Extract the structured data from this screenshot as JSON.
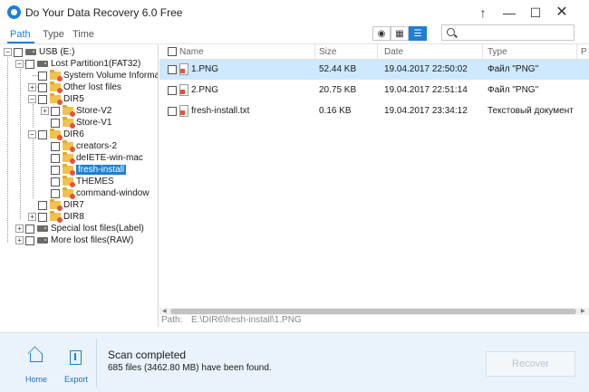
{
  "window": {
    "title": "Do Your Data Recovery 6.0 Free",
    "icons": [
      "app-logo-icon",
      "upgrade-arrow-icon",
      "minimize-icon",
      "maximize-icon",
      "close-icon"
    ]
  },
  "tabs": [
    {
      "label": "Path",
      "active": true
    },
    {
      "label": "Type",
      "active": false
    },
    {
      "label": "Time",
      "active": false
    }
  ],
  "view_modes": [
    "preview-eye-icon",
    "thumbnail-grid-icon",
    "list-view-icon"
  ],
  "active_view": "list",
  "search": {
    "value": "",
    "placeholder": ""
  },
  "tree": {
    "usb": "USB (E:)",
    "lost_partition": "Lost Partition1(FAT32)",
    "system_volume": "System Volume Information",
    "other_lost": "Other lost files",
    "dir5": "DIR5",
    "store_v2": "Store-V2",
    "store_v1": "Store-V1",
    "dir6": "DIR6",
    "creators2": "creators-2",
    "delete_win_mac": "deIETE-win-mac",
    "fresh_install": "fresh-install",
    "themes": "THEMES",
    "command_window": "command-window",
    "dir7": "DIR7",
    "dir8": "DIR8",
    "special_lost": "Special lost files(Label)",
    "more_lost": "More lost files(RAW)"
  },
  "columns": {
    "name": "Name",
    "size": "Size",
    "date": "Date",
    "type": "Type",
    "extra": "P"
  },
  "files": [
    {
      "name": "1.PNG",
      "size": "52.44 KB",
      "date": "19.04.2017 22:50:02",
      "type": "Файл \"PNG\"",
      "selected": true
    },
    {
      "name": "2.PNG",
      "size": "20.75 KB",
      "date": "19.04.2017 22:51:14",
      "type": "Файл \"PNG\"",
      "selected": false
    },
    {
      "name": "fresh-install.txt",
      "size": "0.16 KB",
      "date": "19.04.2017 23:34:12",
      "type": "Текстовый документ",
      "selected": false
    }
  ],
  "path": {
    "label": "Path:",
    "value": "E:\\DIR6\\fresh-install\\1.PNG"
  },
  "bottom": {
    "home_label": "Home",
    "export_label": "Export",
    "scan_title": "Scan completed",
    "scan_sub": "685 files (3462.80 MB) have been found.",
    "recover_label": "Recover"
  }
}
